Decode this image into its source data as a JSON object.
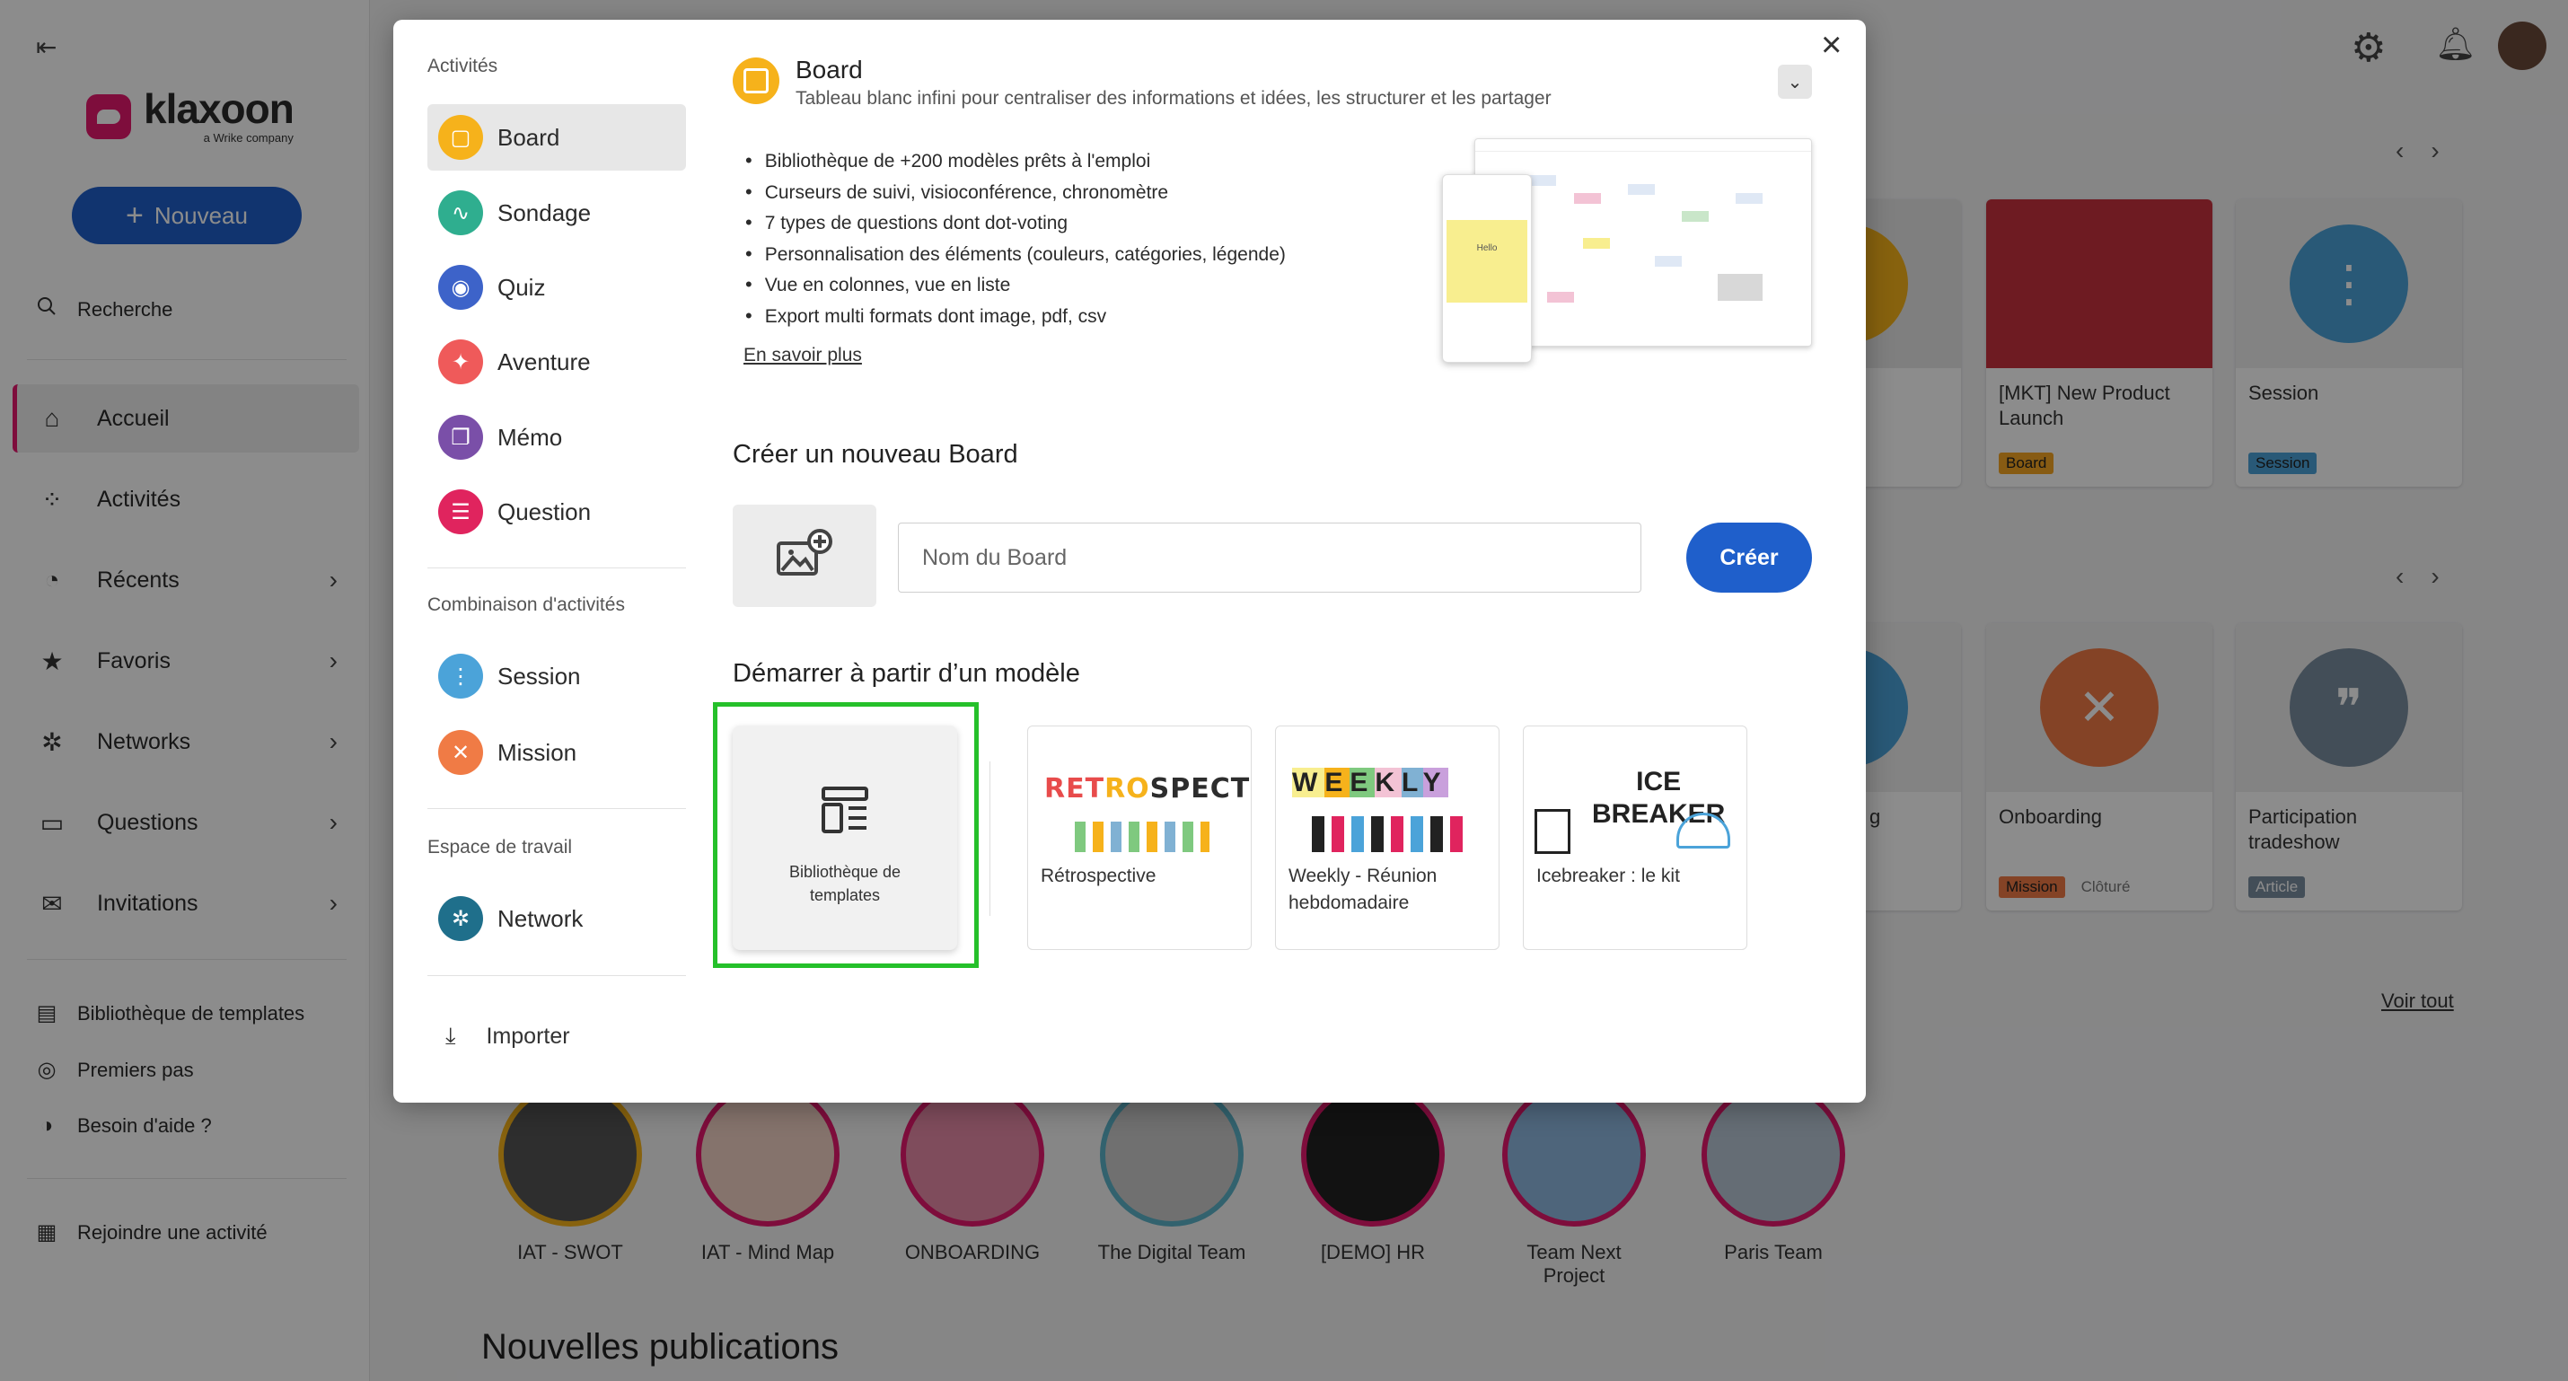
{
  "sidebar": {
    "logo_word": "klaxoon",
    "logo_sub": "a Wrike company",
    "new_button": "Nouveau",
    "search": "Recherche",
    "nav": [
      {
        "label": "Accueil",
        "icon": "home-icon"
      },
      {
        "label": "Activités",
        "icon": "grid-icon"
      },
      {
        "label": "Récents",
        "icon": "clock-icon"
      },
      {
        "label": "Favoris",
        "icon": "star-icon"
      },
      {
        "label": "Networks",
        "icon": "network-icon"
      },
      {
        "label": "Questions",
        "icon": "questions-icon"
      },
      {
        "label": "Invitations",
        "icon": "mail-icon"
      }
    ],
    "bottom": [
      {
        "label": "Bibliothèque de templates"
      },
      {
        "label": "Premiers pas"
      },
      {
        "label": "Besoin d'aide ?"
      }
    ],
    "join": "Rejoindre une activité"
  },
  "background": {
    "cards_row1": [
      {
        "title": "[MKT] New Product Launch",
        "tag": "Board"
      },
      {
        "title": "Session",
        "tag": "Session"
      }
    ],
    "cards_row2": [
      {
        "title": "Onboarding",
        "tag": "Mission",
        "status": "Clôturé"
      },
      {
        "title": "Participation tradeshow",
        "tag": "Article"
      }
    ],
    "partial_letter": "g",
    "see_all": "Voir tout",
    "networks": [
      "IAT - SWOT",
      "IAT - Mind Map",
      "ONBOARDING",
      "The Digital Team",
      "[DEMO] HR",
      "Team Next Project",
      "Paris Team"
    ],
    "publications_title": "Nouvelles publications"
  },
  "modal": {
    "section_activities": "Activités",
    "activities": [
      {
        "label": "Board",
        "color": "#f6b21b",
        "icon": "board-icon"
      },
      {
        "label": "Sondage",
        "color": "#2fae8f",
        "icon": "survey-icon"
      },
      {
        "label": "Quiz",
        "color": "#3d63c9",
        "icon": "quiz-icon"
      },
      {
        "label": "Aventure",
        "color": "#ef5a5a",
        "icon": "adventure-icon"
      },
      {
        "label": "Mémo",
        "color": "#7a4fa8",
        "icon": "memo-icon"
      },
      {
        "label": "Question",
        "color": "#e0245e",
        "icon": "question-icon"
      }
    ],
    "section_combination": "Combinaison d'activités",
    "combinations": [
      {
        "label": "Session",
        "color": "#4ba3d9",
        "icon": "session-icon"
      },
      {
        "label": "Mission",
        "color": "#f07b45",
        "icon": "mission-icon"
      }
    ],
    "section_workspace": "Espace de travail",
    "workspace": [
      {
        "label": "Network",
        "color": "#1f6f8b",
        "icon": "network-icon"
      }
    ],
    "import": "Importer",
    "header": {
      "title": "Board",
      "description": "Tableau blanc infini pour centraliser des informations et idées, les structurer et les partager"
    },
    "features": [
      "Bibliothèque de +200 modèles prêts à l'emploi",
      "Curseurs de suivi, visioconférence, chronomètre",
      "7 types de questions dont dot-voting",
      "Personnalisation des éléments (couleurs, catégories, légende)",
      "Vue en colonnes, vue en liste",
      "Export multi formats dont image, pdf, csv"
    ],
    "learn_more": "En savoir plus",
    "preview_note": "Hello",
    "create_title": "Créer un nouveau Board",
    "name_placeholder": "Nom du Board",
    "create_button": "Créer",
    "start_title": "Démarrer à partir d’un modèle",
    "template_library": "Bibliothèque de templates",
    "templates": [
      {
        "title": "Rétrospective",
        "art": "RETROSPECTIVE"
      },
      {
        "title": "Weekly - Réunion hebdomadaire",
        "art": "WEEKLY"
      },
      {
        "title": "Icebreaker : le kit",
        "art": "ICE BREAKER"
      }
    ]
  }
}
